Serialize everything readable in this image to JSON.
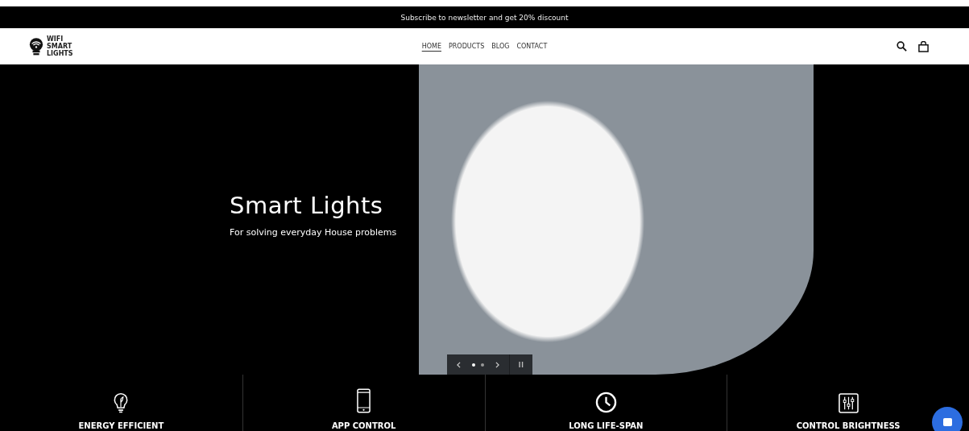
{
  "announcement": "Subscribe to newsletter and get 20% discount",
  "logo": {
    "lines": [
      "WIFI",
      "SMART",
      "LIGHTS"
    ]
  },
  "nav": [
    {
      "label": "HOME",
      "selected": true
    },
    {
      "label": "PRODUCTS",
      "selected": false
    },
    {
      "label": "BLOG",
      "selected": false
    },
    {
      "label": "CONTACT",
      "selected": false
    }
  ],
  "hero": {
    "title": "Smart Lights",
    "subtitle": "For solving everyday House problems",
    "slides": [
      {
        "selected": true
      },
      {
        "selected": false
      }
    ]
  },
  "features": [
    {
      "kind": "bulb",
      "label": "ENERGY EFFICIENT"
    },
    {
      "kind": "phone",
      "label": "APP CONTROL"
    },
    {
      "kind": "clock",
      "label": "LONG LIFE-SPAN"
    },
    {
      "kind": "sliders",
      "label": "CONTROL BRIGHTNESS"
    }
  ]
}
